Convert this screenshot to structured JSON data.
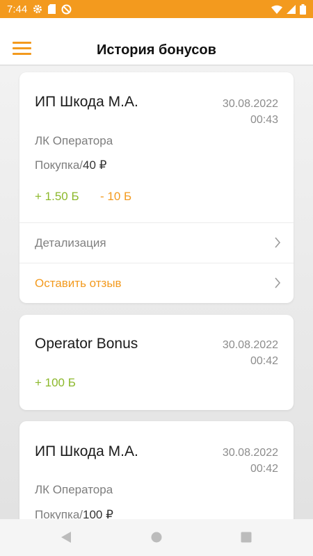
{
  "status_bar": {
    "time": "7:44"
  },
  "header": {
    "title": "История бонусов"
  },
  "cards": [
    {
      "title": "ИП Шкода М.А.",
      "date": "30.08.2022",
      "time": "00:43",
      "operator": "ЛК Оператора",
      "purchase_label": "Покупка/",
      "purchase_amount": "40 ₽",
      "bonus_plus": "+ 1.50 Б",
      "bonus_minus": "- 10 Б",
      "details_label": "Детализация",
      "review_label": "Оставить отзыв"
    },
    {
      "title": "Operator Bonus",
      "date": "30.08.2022",
      "time": "00:42",
      "bonus_plus": "+ 100 Б"
    },
    {
      "title": "ИП Шкода М.А.",
      "date": "30.08.2022",
      "time": "00:42",
      "operator": "ЛК Оператора",
      "purchase_label": "Покупка/",
      "purchase_amount": "100 ₽"
    }
  ],
  "colors": {
    "accent": "#f39a1e",
    "bonus_green": "#8cb82b",
    "muted": "#8c8c8c"
  }
}
